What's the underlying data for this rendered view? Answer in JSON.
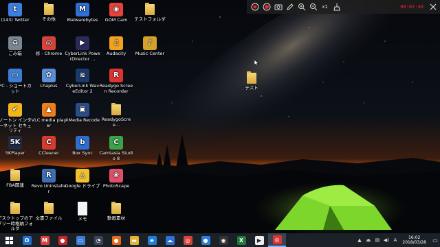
{
  "desktop_icons": [
    {
      "id": "twitter",
      "label": "(143) Twitter",
      "glyph": "t",
      "color": "#3d7fe0",
      "kind": "app"
    },
    {
      "id": "sonota",
      "label": "その他",
      "kind": "folder"
    },
    {
      "id": "malwarebytes",
      "label": "Malwarebytes",
      "glyph": "M",
      "color": "#2f6fd8",
      "kind": "app"
    },
    {
      "id": "gomcam",
      "label": "GOM Cam",
      "glyph": "◉",
      "color": "#e8403a",
      "kind": "app"
    },
    {
      "id": "testfolder",
      "label": "テストフォルダ",
      "kind": "folder"
    },
    {
      "id": "gomibako",
      "label": "ごみ箱",
      "glyph": "♻",
      "color": "#7a8694",
      "kind": "app"
    },
    {
      "id": "chrome",
      "label": "修 - Chrome",
      "glyph": "◎",
      "color": "#d9423a",
      "kind": "app"
    },
    {
      "id": "powerdirector",
      "label": "CyberLink PowerDirector ...",
      "glyph": "▶",
      "color": "#2b2b5a",
      "kind": "app"
    },
    {
      "id": "audacity",
      "label": "Audacity",
      "glyph": "♫",
      "color": "#f1a31f",
      "kind": "app"
    },
    {
      "id": "musiccenter",
      "label": "Music Center",
      "glyph": "♪",
      "color": "#d2a22a",
      "kind": "app"
    },
    {
      "id": "pc",
      "label": "PC - ショートカット",
      "glyph": "▭",
      "color": "#3c7ed4",
      "kind": "app"
    },
    {
      "id": "lhaplus",
      "label": "Lhaplus",
      "glyph": "✿",
      "color": "#5a8fd8",
      "kind": "app"
    },
    {
      "id": "wavededitor",
      "label": "CyberLink WaveEditor 2",
      "glyph": "≋",
      "color": "#1b3a6b",
      "kind": "app"
    },
    {
      "id": "readygo",
      "label": "Readygo Screen Recorder",
      "glyph": "R",
      "color": "#d33",
      "kind": "app"
    },
    {
      "id": "blank1",
      "label": "",
      "kind": "none"
    },
    {
      "id": "norton",
      "label": "ノートン インターネット セキュリティ",
      "glyph": "✔",
      "color": "#f2b51c",
      "kind": "app"
    },
    {
      "id": "vlc",
      "label": "VLC media player",
      "glyph": "▲",
      "color": "#f07d1a",
      "kind": "app"
    },
    {
      "id": "xmedia",
      "label": "XMedia Recode",
      "glyph": "▣",
      "color": "#2a4c8a",
      "kind": "app"
    },
    {
      "id": "readygo2",
      "label": "ReadygoScree...",
      "kind": "folder"
    },
    {
      "id": "blank2",
      "label": "",
      "kind": "none"
    },
    {
      "id": "5kplayer",
      "label": "5KPlayer",
      "glyph": "5K",
      "color": "#1f2a44",
      "kind": "app"
    },
    {
      "id": "ccleaner",
      "label": "CCleaner",
      "glyph": "C",
      "color": "#d63b2f",
      "kind": "app"
    },
    {
      "id": "boxsync",
      "label": "Box Sync",
      "glyph": "b",
      "color": "#2c6fd1",
      "kind": "app"
    },
    {
      "id": "camtasia",
      "label": "Camtasia Studio 8",
      "glyph": "C",
      "color": "#3aa24a",
      "kind": "app"
    },
    {
      "id": "blank3",
      "label": "",
      "kind": "none"
    },
    {
      "id": "fba",
      "label": "FBA関連",
      "kind": "folder"
    },
    {
      "id": "revo",
      "label": "Revo Uninstaller",
      "glyph": "R",
      "color": "#3d6fb6",
      "kind": "app"
    },
    {
      "id": "googledrive",
      "label": "Google ドライブ",
      "glyph": "△",
      "color": "#f2c12e",
      "kind": "app"
    },
    {
      "id": "photoscape",
      "label": "PhotoScape",
      "glyph": "❀",
      "color": "#e04e6a",
      "kind": "app"
    },
    {
      "id": "blank4",
      "label": "",
      "kind": "none"
    },
    {
      "id": "desktopapps",
      "label": "デスクトップのアプリー時格納フォルダ",
      "kind": "folder"
    },
    {
      "id": "bunsho",
      "label": "文書ファイル",
      "kind": "folder"
    },
    {
      "id": "memo",
      "label": "メモ",
      "glyph": "",
      "color": "#f4f4f4",
      "kind": "doc"
    },
    {
      "id": "douga",
      "label": "動画素材",
      "kind": "folder"
    }
  ],
  "loose_icon": {
    "label": "テスト",
    "kind": "folder"
  },
  "recorder_bar": {
    "time": "00:02:46",
    "zoom_label": "x1",
    "buttons": [
      "stop-circle-icon",
      "record-icon",
      "camera-icon",
      "pen-icon",
      "zoom-in-icon",
      "zoom-out-icon",
      "zoom-level",
      "broom-icon"
    ]
  },
  "taskbar": {
    "apps": [
      {
        "name": "outlook",
        "glyph": "O",
        "color": "#1f6fd0"
      },
      {
        "name": "gmail",
        "glyph": "M",
        "color": "#d9443a"
      },
      {
        "name": "gomcam-task",
        "glyph": "●",
        "color": "#c62828"
      },
      {
        "name": "pc-task",
        "glyph": "▭",
        "color": "#3c7ed4"
      },
      {
        "name": "music-task",
        "glyph": "◔",
        "color": "#3a4455"
      },
      {
        "name": "firefox",
        "glyph": "●",
        "color": "#e66a1d"
      },
      {
        "name": "explorer",
        "glyph": "▬",
        "color": "#e6b232"
      },
      {
        "name": "edge",
        "glyph": "e",
        "color": "#1f7fd8"
      },
      {
        "name": "onedrive",
        "glyph": "☁",
        "color": "#2f72d6"
      },
      {
        "name": "chrome-task",
        "glyph": "◎",
        "color": "#d9423a"
      },
      {
        "name": "ie-task",
        "glyph": "●",
        "color": "#2a7fd8"
      },
      {
        "name": "media-task",
        "glyph": "◉",
        "color": "#333"
      },
      {
        "name": "excel",
        "glyph": "X",
        "color": "#1f7a3c"
      },
      {
        "name": "play-task",
        "glyph": "▶",
        "color": "#eeeeee"
      },
      {
        "name": "recorder-task",
        "glyph": "◎",
        "color": "#d33"
      }
    ],
    "active_app": "recorder-task"
  },
  "clock": {
    "time": "16:02",
    "date": "2018/03/28"
  },
  "accent_color": "#f07d1a"
}
